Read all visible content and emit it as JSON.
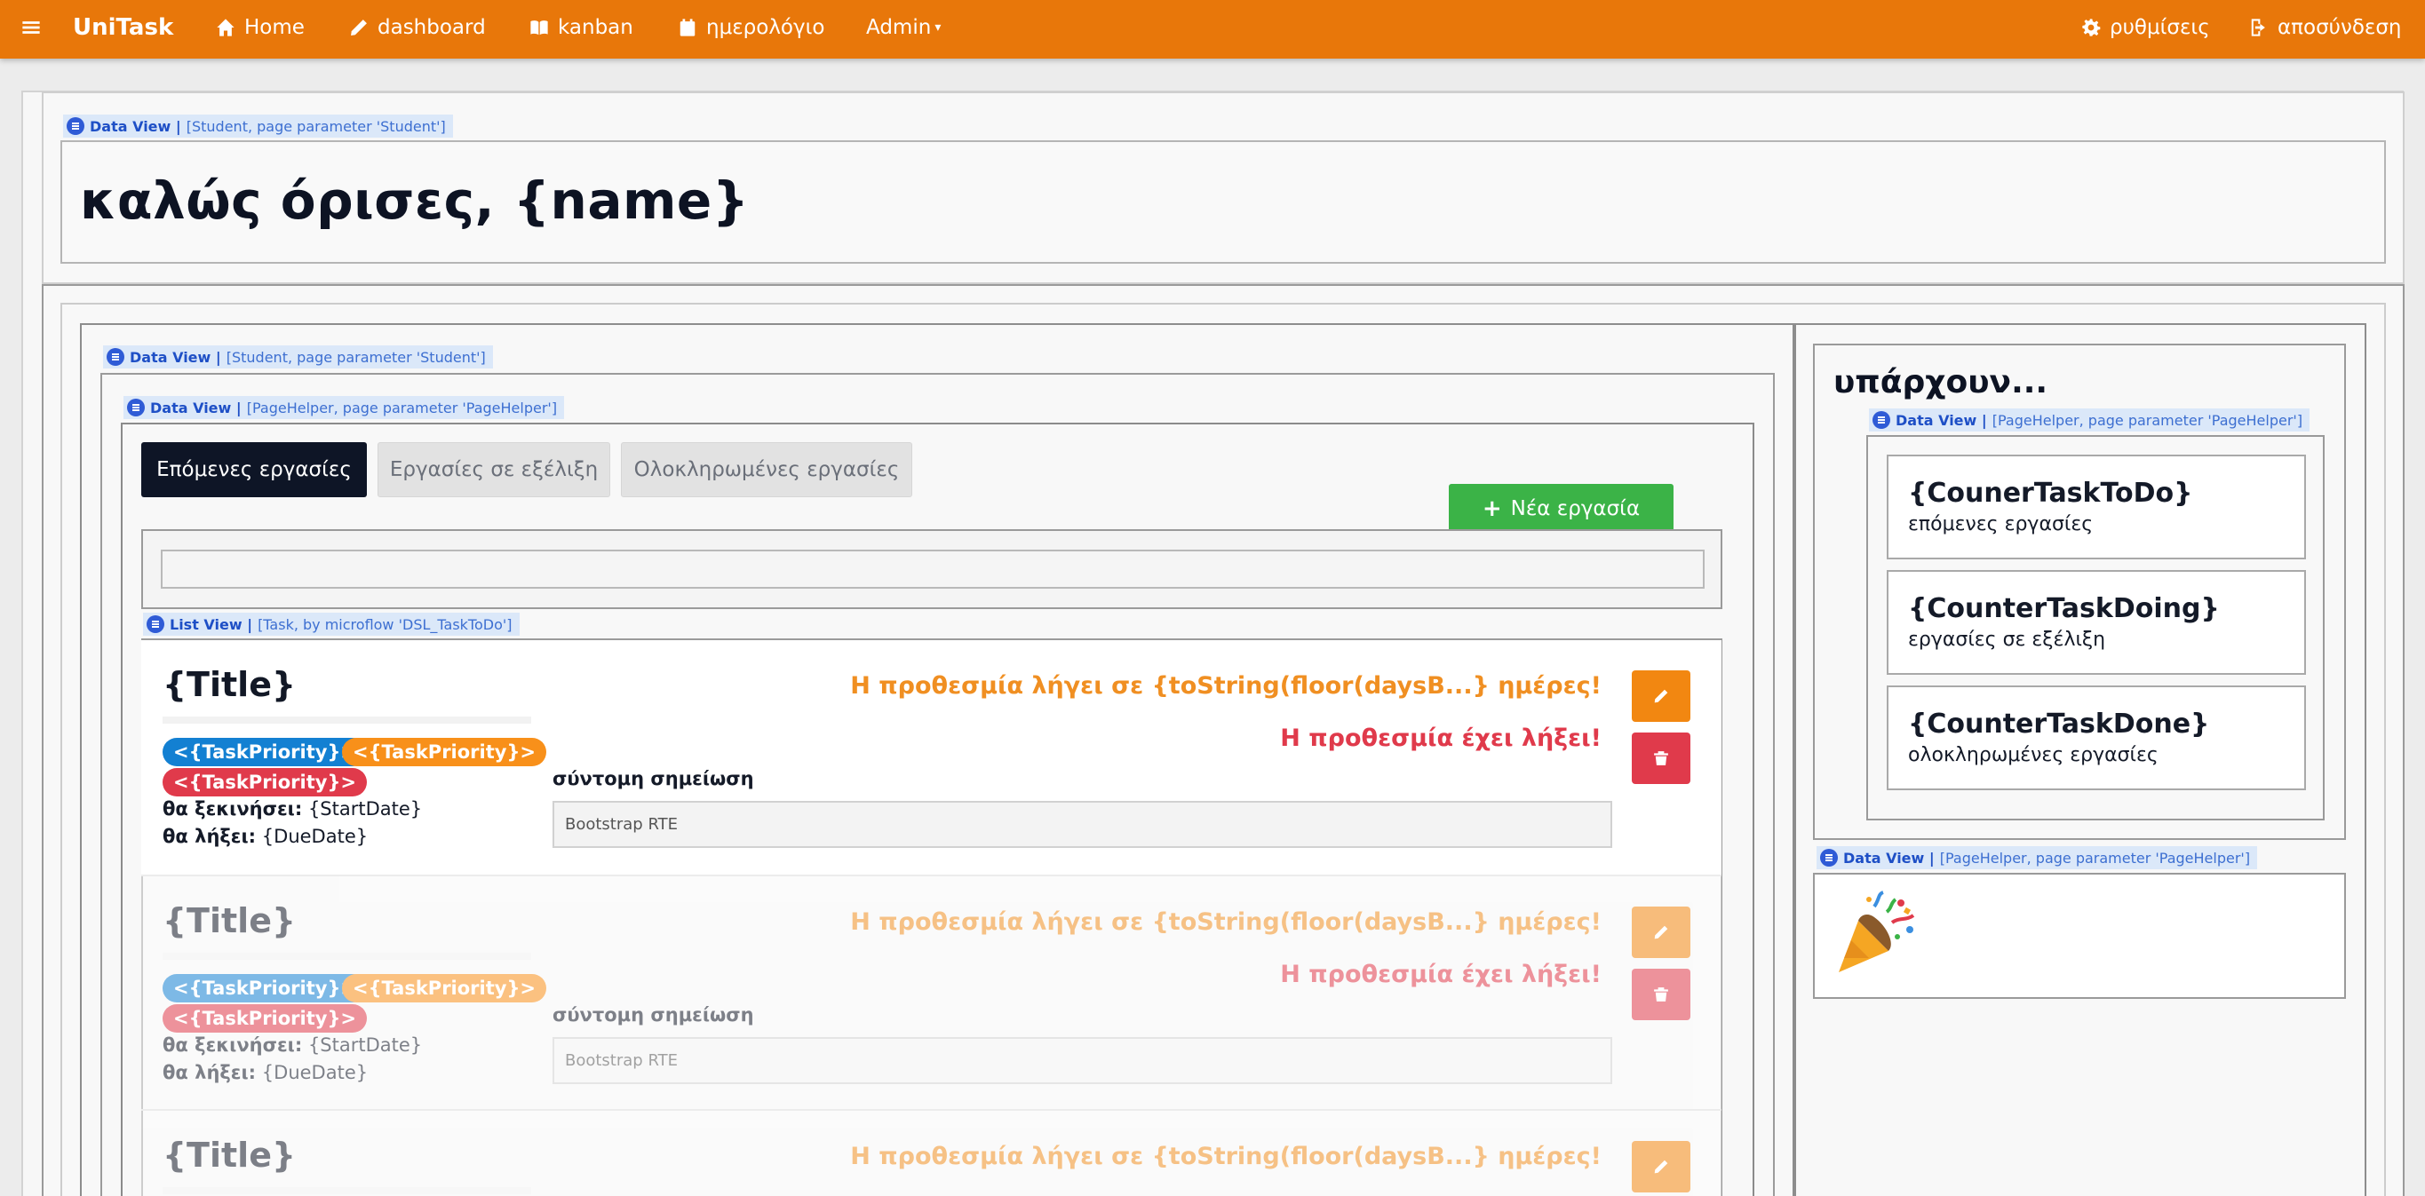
{
  "navbar": {
    "brand": "UniTask",
    "items": [
      {
        "label": "Home",
        "icon": "home-icon"
      },
      {
        "label": "dashboard",
        "icon": "pencil-icon"
      },
      {
        "label": "kanban",
        "icon": "book-icon"
      },
      {
        "label": "ημερολόγιο",
        "icon": "calendar-icon"
      }
    ],
    "admin_label": "Admin",
    "settings_label": "ρυθμίσεις",
    "logout_label": "αποσύνδεση",
    "colors": {
      "bar": "#e8770a"
    }
  },
  "dataviews": {
    "student": {
      "kind": "Data View |",
      "source": "[Student, page parameter 'Student']"
    },
    "pagehelper": {
      "kind": "Data View |",
      "source": "[PageHelper, page parameter 'PageHelper']"
    },
    "listview": {
      "kind": "List View |",
      "source": "[Task, by microflow 'DSL_TaskToDo']"
    }
  },
  "welcome": "καλώς όρισες, {name}",
  "tabs": [
    "Επόμενες εργασίες",
    "Εργασίες σε εξέλιξη",
    "Ολοκληρωμένες εργασίες"
  ],
  "active_tab": "Επόμενες εργασίες",
  "new_task_label": "Νέα εργασία",
  "task": {
    "title": "{Title}",
    "priority": "<{TaskPriority}>",
    "start_label": "θα ξεκινήσει:",
    "start_value": "{StartDate}",
    "due_label": "θα λήξει:",
    "due_value": "{DueDate}",
    "deadline_warning": "Η προθεσμία λήγει σε {toString(floor(daysB...} ημέρες!",
    "deadline_expired": "Η προθεσμία έχει λήξει!",
    "note_label": "σύντομη σημείωση",
    "rte_placeholder": "Bootstrap RTE"
  },
  "sidebar": {
    "title": "υπάρχουν...",
    "todo_counter": "{CounerTaskToDo}",
    "todo_text": "επόμενες εργασίες",
    "doing_counter": "{CounterTaskDoing}",
    "doing_text": "εργασίες σε εξέλιξη",
    "done_counter": "{CounterTaskDone}",
    "done_text": "ολοκληρωμένες εργασίες",
    "celebration_icon": "party-popper-icon"
  },
  "colors": {
    "primary_dark": "#0e1526",
    "success": "#3bb347",
    "warning": "#f08f22",
    "danger": "#e03a4b",
    "info": "#1380d2"
  }
}
